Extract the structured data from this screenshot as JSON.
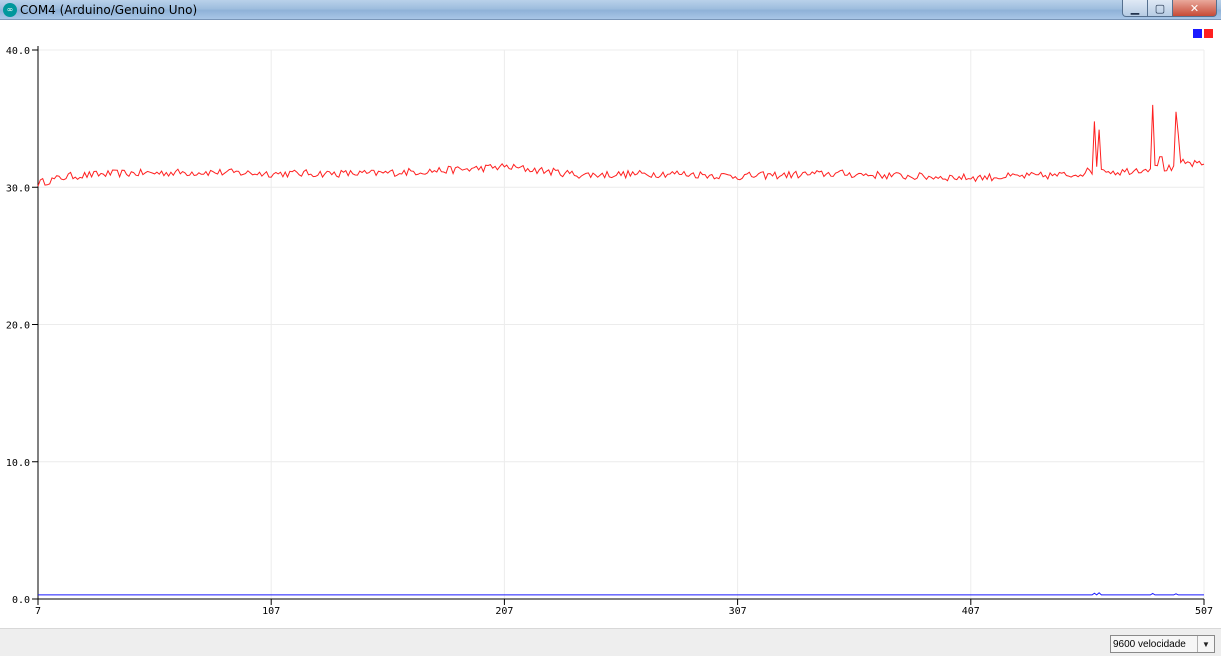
{
  "window": {
    "title": "COM4 (Arduino/Genuino Uno)",
    "buttons": [
      "minimize",
      "maximize",
      "close"
    ]
  },
  "legend": {
    "colors": [
      "#1a1aff",
      "#ff2020"
    ]
  },
  "baud_select": {
    "value": "9600 velocidade"
  },
  "chart_data": {
    "type": "line",
    "x_start": 7,
    "x_end": 507,
    "x_ticks": [
      "7",
      "107",
      "207",
      "307",
      "407",
      "507"
    ],
    "y_ticks": [
      "0.0",
      "10.0",
      "20.0",
      "30.0",
      "40.0"
    ],
    "ylim": [
      0,
      40
    ],
    "grid": true,
    "legend_placement": "top-right",
    "series": [
      {
        "color": "#ff2020",
        "keypoints": [
          [
            7,
            30.3
          ],
          [
            20,
            30.8
          ],
          [
            40,
            31.0
          ],
          [
            80,
            31.1
          ],
          [
            107,
            31.0
          ],
          [
            150,
            31.0
          ],
          [
            190,
            31.3
          ],
          [
            207,
            31.5
          ],
          [
            240,
            30.9
          ],
          [
            280,
            31.0
          ],
          [
            307,
            30.8
          ],
          [
            350,
            31.0
          ],
          [
            380,
            30.8
          ],
          [
            407,
            30.7
          ],
          [
            430,
            30.8
          ],
          [
            450,
            30.9
          ],
          [
            459,
            31.2
          ],
          [
            460,
            34.8
          ],
          [
            461,
            31.5
          ],
          [
            462,
            34.2
          ],
          [
            463,
            31.3
          ],
          [
            470,
            31.1
          ],
          [
            484,
            31.4
          ],
          [
            485,
            36.0
          ],
          [
            486,
            31.6
          ],
          [
            489,
            32.2
          ],
          [
            490,
            31.4
          ],
          [
            494,
            31.3
          ],
          [
            495,
            35.5
          ],
          [
            497,
            31.8
          ],
          [
            507,
            31.6
          ]
        ],
        "noise_amplitude": 0.28
      },
      {
        "color": "#1a1aff",
        "keypoints": [
          [
            7,
            0.3
          ],
          [
            507,
            0.3
          ]
        ],
        "small_bumps": [
          [
            460,
            0.42
          ],
          [
            462,
            0.45
          ],
          [
            485,
            0.4
          ],
          [
            495,
            0.38
          ]
        ]
      }
    ]
  }
}
